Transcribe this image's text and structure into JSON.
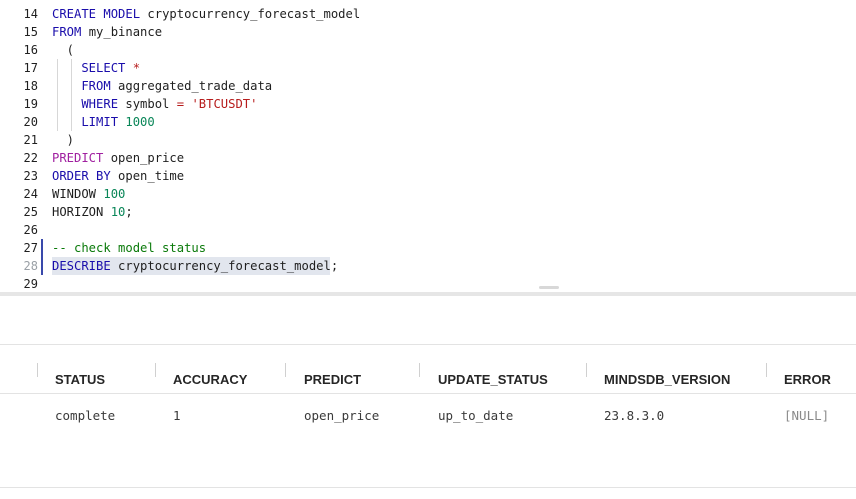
{
  "editor": {
    "lines": [
      {
        "num": "14",
        "tokens": [
          {
            "t": "CREATE MODEL ",
            "c": "kw"
          },
          {
            "t": "cryptocurrency_forecast_model",
            "c": "plain"
          }
        ]
      },
      {
        "num": "15",
        "tokens": [
          {
            "t": "FROM ",
            "c": "kw"
          },
          {
            "t": "my_binance",
            "c": "plain"
          }
        ]
      },
      {
        "num": "16",
        "tokens": [
          {
            "t": "  (",
            "c": "plain"
          }
        ]
      },
      {
        "num": "17",
        "tokens": [
          {
            "t": "    SELECT ",
            "c": "kw"
          },
          {
            "t": "*",
            "c": "str"
          }
        ]
      },
      {
        "num": "18",
        "tokens": [
          {
            "t": "    FROM ",
            "c": "kw"
          },
          {
            "t": "aggregated_trade_data",
            "c": "plain"
          }
        ]
      },
      {
        "num": "19",
        "tokens": [
          {
            "t": "    WHERE ",
            "c": "kw"
          },
          {
            "t": "symbol ",
            "c": "plain"
          },
          {
            "t": "= ",
            "c": "str"
          },
          {
            "t": "'BTCUSDT'",
            "c": "str"
          }
        ]
      },
      {
        "num": "20",
        "tokens": [
          {
            "t": "    LIMIT ",
            "c": "kw"
          },
          {
            "t": "1000",
            "c": "num"
          }
        ]
      },
      {
        "num": "21",
        "tokens": [
          {
            "t": "  )",
            "c": "plain"
          }
        ]
      },
      {
        "num": "22",
        "tokens": [
          {
            "t": "PREDICT ",
            "c": "kw2"
          },
          {
            "t": "open_price",
            "c": "plain"
          }
        ]
      },
      {
        "num": "23",
        "tokens": [
          {
            "t": "ORDER BY ",
            "c": "kw"
          },
          {
            "t": "open_time",
            "c": "plain"
          }
        ]
      },
      {
        "num": "24",
        "tokens": [
          {
            "t": "WINDOW ",
            "c": "plain"
          },
          {
            "t": "100",
            "c": "num"
          }
        ]
      },
      {
        "num": "25",
        "tokens": [
          {
            "t": "HORIZON ",
            "c": "plain"
          },
          {
            "t": "10",
            "c": "num"
          },
          {
            "t": ";",
            "c": "plain"
          }
        ]
      },
      {
        "num": "26",
        "tokens": []
      },
      {
        "num": "27",
        "tokens": [
          {
            "t": "-- check model status",
            "c": "cmt"
          }
        ]
      },
      {
        "num": "28",
        "tokens": [
          {
            "t": "DESCRIBE ",
            "c": "kw"
          },
          {
            "t": "cryptocurrency_forecast_model;",
            "c": "plain"
          }
        ]
      },
      {
        "num": "29",
        "tokens": []
      }
    ]
  },
  "results": {
    "columns": [
      "STATUS",
      "ACCURACY",
      "PREDICT",
      "UPDATE_STATUS",
      "MINDSDB_VERSION",
      "ERROR"
    ],
    "rows": [
      [
        "complete",
        "1",
        "open_price",
        "up_to_date",
        "23.8.3.0",
        "[NULL]"
      ]
    ]
  }
}
